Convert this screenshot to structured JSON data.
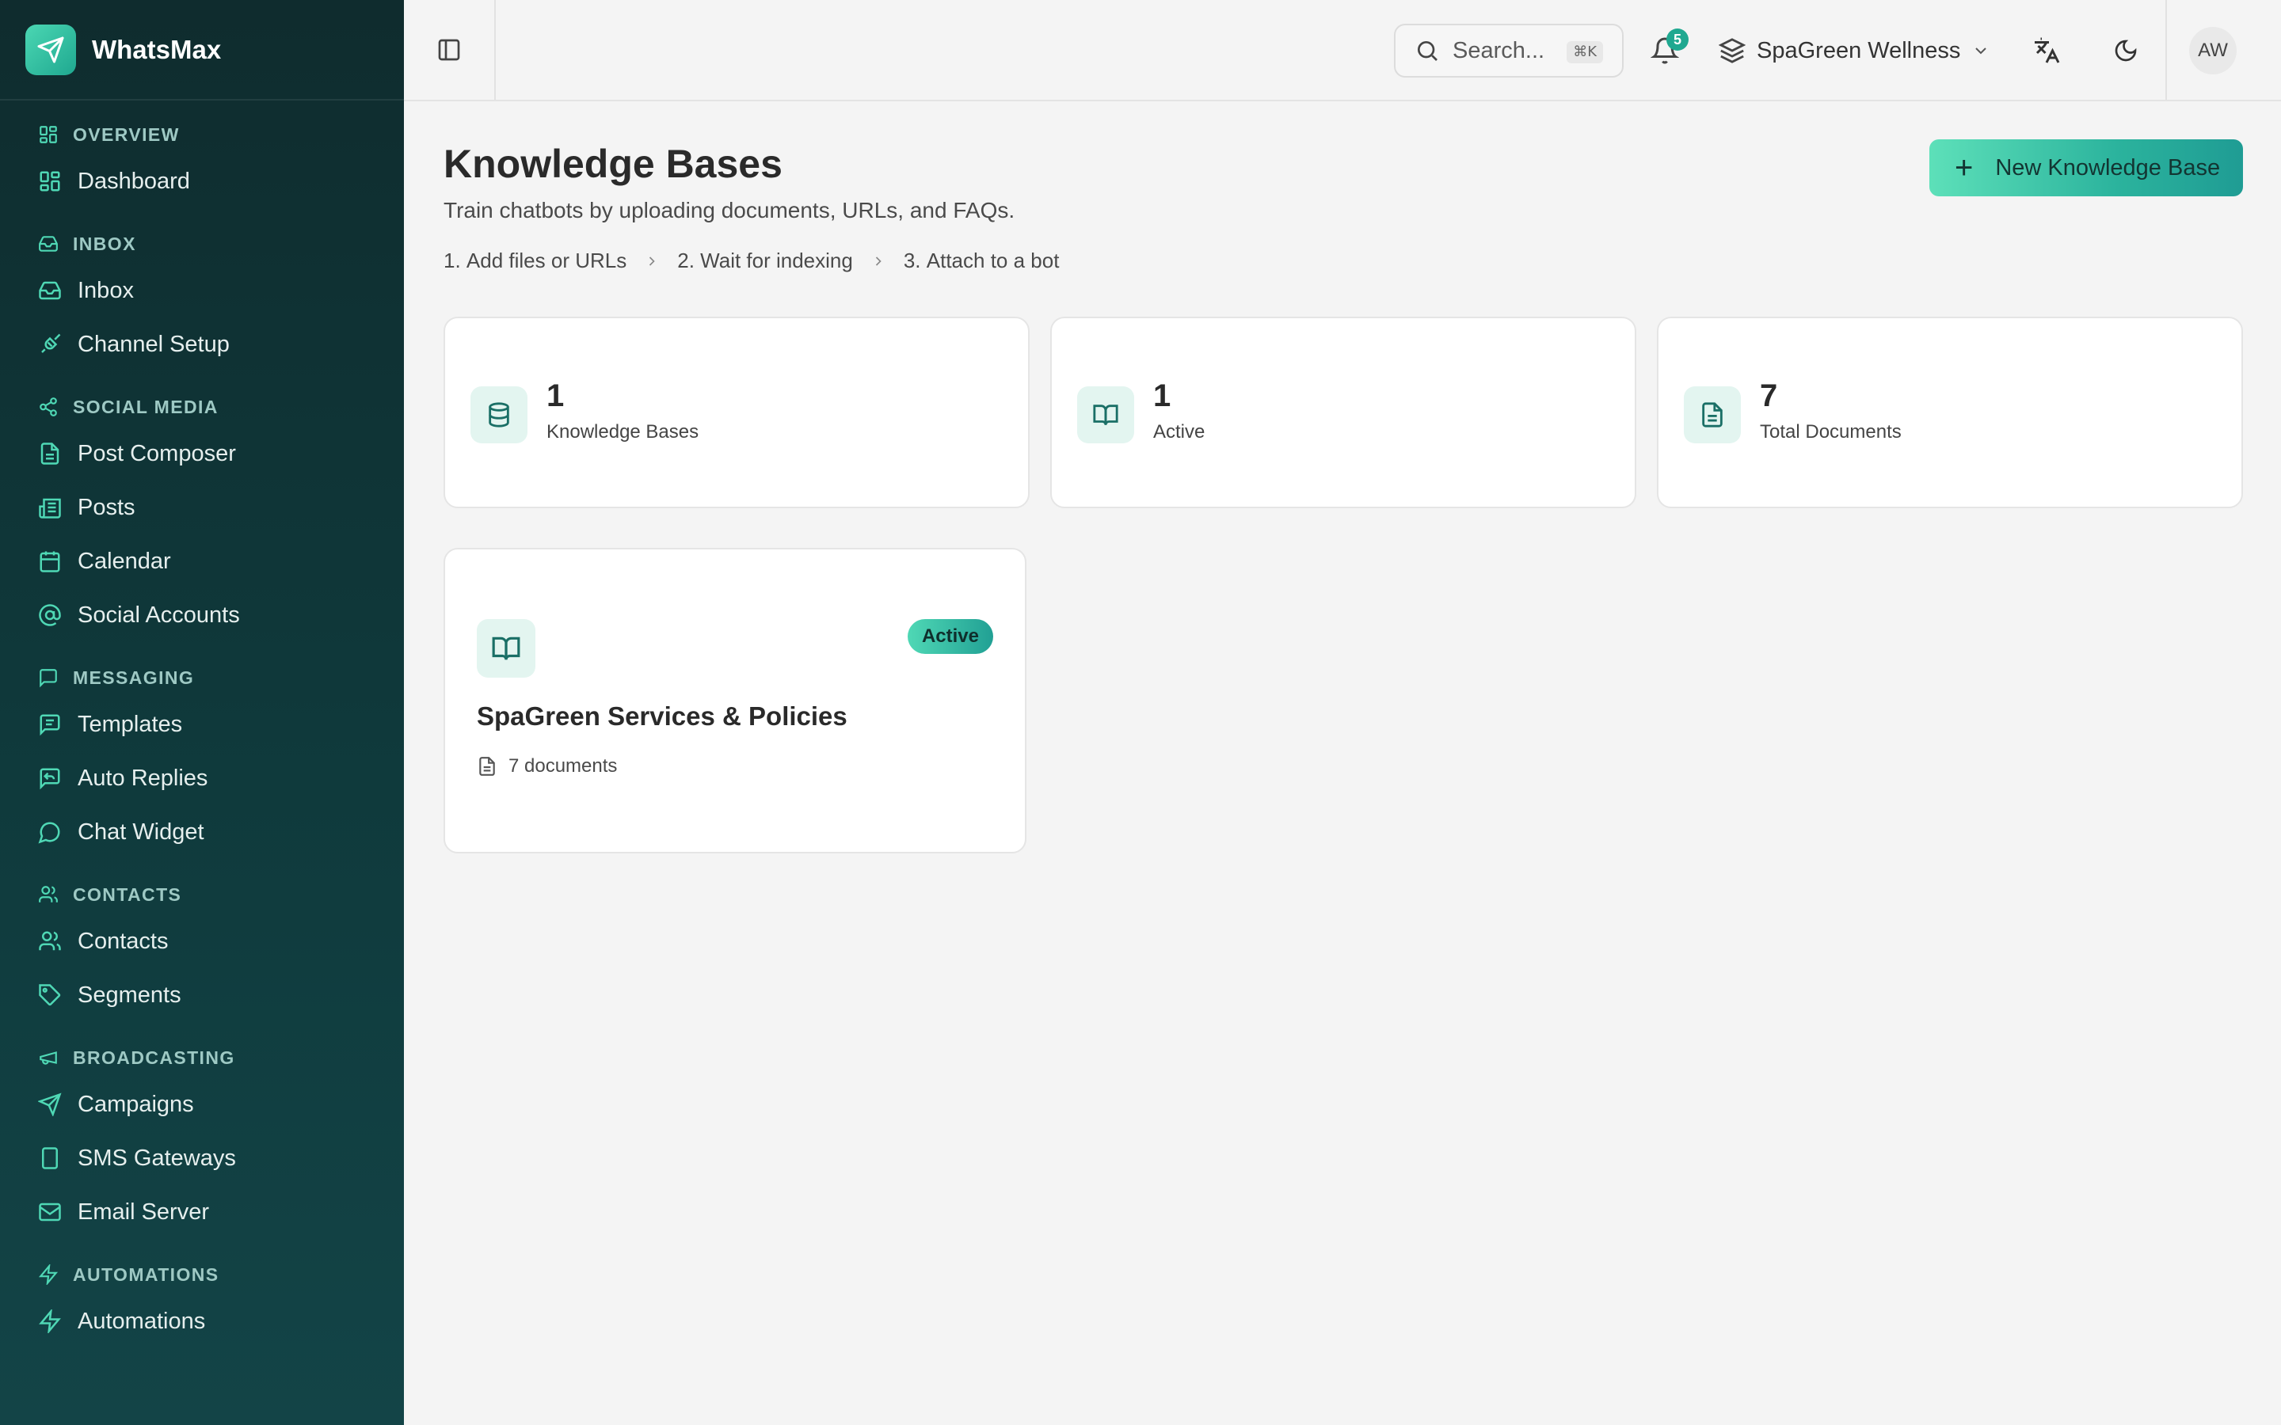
{
  "app": {
    "name": "WhatsMax"
  },
  "sidebar": {
    "sections": [
      {
        "label": "OVERVIEW",
        "icon": "dashboard-icon",
        "items": [
          {
            "label": "Dashboard",
            "icon": "dashboard-icon"
          }
        ]
      },
      {
        "label": "INBOX",
        "icon": "inbox-icon",
        "items": [
          {
            "label": "Inbox",
            "icon": "inbox-icon"
          },
          {
            "label": "Channel Setup",
            "icon": "plug-icon"
          }
        ]
      },
      {
        "label": "SOCIAL MEDIA",
        "icon": "share-icon",
        "items": [
          {
            "label": "Post Composer",
            "icon": "document-icon"
          },
          {
            "label": "Posts",
            "icon": "newspaper-icon"
          },
          {
            "label": "Calendar",
            "icon": "calendar-icon"
          },
          {
            "label": "Social Accounts",
            "icon": "at-icon"
          }
        ]
      },
      {
        "label": "MESSAGING",
        "icon": "message-icon",
        "items": [
          {
            "label": "Templates",
            "icon": "template-icon"
          },
          {
            "label": "Auto Replies",
            "icon": "reply-icon"
          },
          {
            "label": "Chat Widget",
            "icon": "chat-bubble-icon"
          }
        ]
      },
      {
        "label": "CONTACTS",
        "icon": "users-icon",
        "items": [
          {
            "label": "Contacts",
            "icon": "users-icon"
          },
          {
            "label": "Segments",
            "icon": "tag-icon"
          }
        ]
      },
      {
        "label": "BROADCASTING",
        "icon": "megaphone-icon",
        "items": [
          {
            "label": "Campaigns",
            "icon": "send-icon"
          },
          {
            "label": "SMS Gateways",
            "icon": "phone-icon"
          },
          {
            "label": "Email Server",
            "icon": "mail-icon"
          }
        ]
      },
      {
        "label": "AUTOMATIONS",
        "icon": "bolt-icon",
        "items": [
          {
            "label": "Automations",
            "icon": "bolt-icon"
          }
        ]
      }
    ]
  },
  "header": {
    "search_placeholder": "Search...",
    "search_shortcut": "⌘K",
    "notifications_count": "5",
    "workspace_name": "SpaGreen Wellness",
    "avatar_initials": "AW"
  },
  "page": {
    "title": "Knowledge Bases",
    "subtitle": "Train chatbots by uploading documents, URLs, and FAQs.",
    "steps": [
      {
        "number": "1.",
        "label": "Add files or URLs"
      },
      {
        "number": "2.",
        "label": "Wait for indexing"
      },
      {
        "number": "3.",
        "label": "Attach to a bot"
      }
    ],
    "new_button_label": "New Knowledge Base"
  },
  "stats": [
    {
      "value": "1",
      "label": "Knowledge Bases",
      "icon": "database-icon"
    },
    {
      "value": "1",
      "label": "Active",
      "icon": "book-open-icon"
    },
    {
      "value": "7",
      "label": "Total Documents",
      "icon": "document-icon"
    }
  ],
  "knowledge_bases": [
    {
      "title": "SpaGreen Services & Policies",
      "status": "Active",
      "documents": "7 documents",
      "icon": "book-open-icon"
    }
  ],
  "colors": {
    "accent": "#1fa890",
    "sidebar_bg": "#0f2c2e",
    "badge_gradient_start": "#4fd8b5",
    "badge_gradient_end": "#21a094"
  }
}
